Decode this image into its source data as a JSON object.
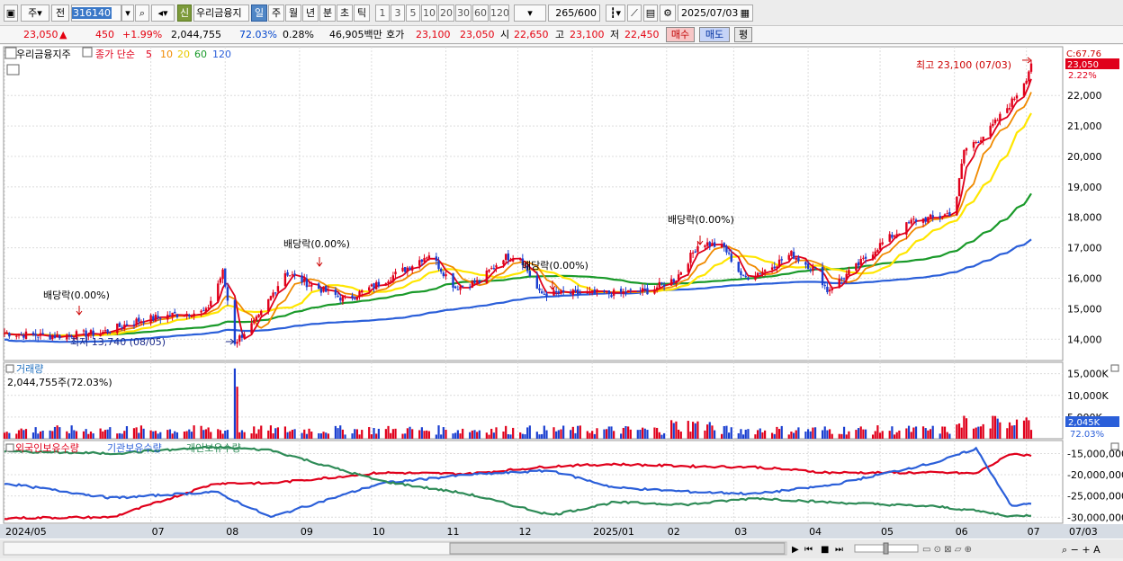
{
  "toolbar": {
    "period_select": "주",
    "prev_label": "전",
    "code": "316140",
    "name": "우리금융지",
    "new_badge": "신",
    "period_tabs": [
      "일",
      "주",
      "월",
      "년",
      "분",
      "초",
      "틱"
    ],
    "active_tab": "일",
    "interval_buttons": [
      "1",
      "3",
      "5",
      "10",
      "20",
      "30",
      "60",
      "120"
    ],
    "count": "265",
    "count_max": "/600",
    "date": "2025/07/03"
  },
  "quote": {
    "price": "23,050",
    "arrow": "▲",
    "change": "450",
    "change_pct": "+1.99%",
    "volume": "2,044,755",
    "vol_ratio": "72.03%",
    "turnover": "0.28%",
    "amount": "46,905백만",
    "hoga_label": "호가",
    "ask": "23,100",
    "bid": "23,050",
    "open_label": "시",
    "open": "22,650",
    "high_label": "고",
    "high": "23,100",
    "low_label": "저",
    "low": "22,450",
    "buy_label": "매수",
    "sell_label": "매도",
    "avg_label": "평"
  },
  "legend": {
    "name": "우리금융지주",
    "ma_label": "종가 단순",
    "periods": [
      "5",
      "10",
      "20",
      "60",
      "120"
    ],
    "colors": [
      "#e0001b",
      "#f08a00",
      "#ffe600",
      "#1a9a2a",
      "#2b5fd9"
    ]
  },
  "annotations": {
    "high": "최고 23,100 (07/03)",
    "low": "최저 13,740 (08/05)",
    "div": [
      "배당락(0.00%)",
      "배당락(0.00%)",
      "배당락(0.00%)",
      "배당락(0.00%)"
    ],
    "current_price": "23,050",
    "current_pct": "2.22%",
    "c_label": "C:67.76"
  },
  "volume_panel": {
    "title": "거래량",
    "value": "2,044,755주(72.03%)",
    "badge": "2,045K",
    "badge_pct": "72.03%",
    "ticks": [
      "15,000K",
      "10,000K",
      "5,000K"
    ]
  },
  "holdings_panel": {
    "legend": [
      "외국인보유수량",
      "기관보유수량",
      "개인보유수량"
    ],
    "colors": [
      "#e0001b",
      "#2b5fd9",
      "#2e8b57"
    ],
    "ticks": [
      "-15,000,000",
      "-20,000,000",
      "-25,000,000",
      "-30,000,000"
    ]
  },
  "x_axis": {
    "labels": [
      "2024/05",
      "07",
      "08",
      "09",
      "10",
      "11",
      "12",
      "2025/01",
      "02",
      "03",
      "04",
      "05",
      "06",
      "07"
    ],
    "right_label": "07/03"
  },
  "chart_data": [
    {
      "type": "candlestick",
      "title": "우리금융지주",
      "ylim": [
        13300,
        23600
      ],
      "y_ticks": [
        14000,
        15000,
        16000,
        17000,
        18000,
        19000,
        20000,
        21000,
        22000
      ],
      "close_series": [
        [
          "2024-05-01",
          14200
        ],
        [
          "2024-05-20",
          14100
        ],
        [
          "2024-06-10",
          14200
        ],
        [
          "2024-06-25",
          14600
        ],
        [
          "2024-07-10",
          14800
        ],
        [
          "2024-07-24",
          14900
        ],
        [
          "2024-07-31",
          16200
        ],
        [
          "2024-08-05",
          13900
        ],
        [
          "2024-08-15",
          14700
        ],
        [
          "2024-08-26",
          16200
        ],
        [
          "2024-09-05",
          15800
        ],
        [
          "2024-09-20",
          15300
        ],
        [
          "2024-10-01",
          15700
        ],
        [
          "2024-10-15",
          16300
        ],
        [
          "2024-10-25",
          16800
        ],
        [
          "2024-11-05",
          15700
        ],
        [
          "2024-11-15",
          15900
        ],
        [
          "2024-11-25",
          16700
        ],
        [
          "2024-12-02",
          16700
        ],
        [
          "2024-12-10",
          15500
        ],
        [
          "2024-12-20",
          15500
        ],
        [
          "2025-01-10",
          15500
        ],
        [
          "2025-01-25",
          15600
        ],
        [
          "2025-02-05",
          16000
        ],
        [
          "2025-02-15",
          17200
        ],
        [
          "2025-02-25",
          17000
        ],
        [
          "2025-03-05",
          16000
        ],
        [
          "2025-03-15",
          16300
        ],
        [
          "2025-03-25",
          16800
        ],
        [
          "2025-04-05",
          16200
        ],
        [
          "2025-04-09",
          15600
        ],
        [
          "2025-04-20",
          16300
        ],
        [
          "2025-05-01",
          17100
        ],
        [
          "2025-05-15",
          17900
        ],
        [
          "2025-05-25",
          18000
        ],
        [
          "2025-06-01",
          18200
        ],
        [
          "2025-06-05",
          20200
        ],
        [
          "2025-06-15",
          20800
        ],
        [
          "2025-06-25",
          21800
        ],
        [
          "2025-07-01",
          22600
        ],
        [
          "2025-07-03",
          23050
        ]
      ],
      "ma_series": [
        {
          "name": "60",
          "values": [
            14300,
            14500,
            15400,
            15500,
            15900,
            15900,
            15900,
            16300,
            17200,
            18800
          ]
        },
        {
          "name": "120",
          "values": [
            13850,
            14300,
            15000,
            15300,
            15600,
            15800,
            15900,
            16100,
            16500,
            17500
          ]
        }
      ],
      "max": {
        "date": "2025-07-03",
        "value": 23100
      },
      "min": {
        "date": "2024-08-05",
        "value": 13740
      },
      "last": 23050
    },
    {
      "type": "bar",
      "title": "거래량",
      "unit": "K",
      "ylim": [
        0,
        17000
      ],
      "notable": [
        {
          "date": "2024-08-05",
          "value": 16200
        },
        {
          "date": "2024-08-06",
          "value": 12000
        }
      ],
      "last": 2045
    },
    {
      "type": "line",
      "title": "보유수량",
      "ylim": [
        -31000000,
        -13000000
      ],
      "series": [
        {
          "name": "외국인보유수량",
          "values": [
            -30200000,
            -30000000,
            -22000000,
            -22000000,
            -19500000,
            -19800000,
            -18000000,
            -17500000,
            -18000000,
            -18200000,
            -19500000,
            -19500000,
            -19700000,
            -15000000,
            -15500000
          ]
        },
        {
          "name": "기관보유수량",
          "values": [
            -22000000,
            -25500000,
            -24000000,
            -30000000,
            -22000000,
            -20000000,
            -19000000,
            -23000000,
            -24000000,
            -24500000,
            -22500000,
            -17000000,
            -13800000,
            -27500000,
            -26700000
          ]
        },
        {
          "name": "개인보유수량",
          "values": [
            -14500000,
            -15000000,
            -13500000,
            -14200000,
            -21500000,
            -24500000,
            -29500000,
            -26500000,
            -27000000,
            -25500000,
            -26500000,
            -27500000,
            -28500000,
            -29800000,
            -29500000
          ]
        }
      ]
    }
  ]
}
